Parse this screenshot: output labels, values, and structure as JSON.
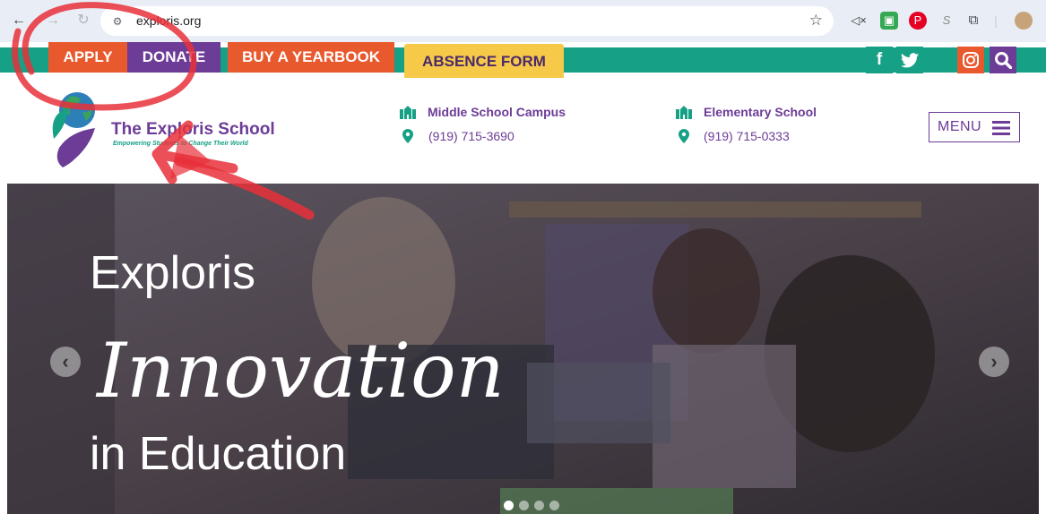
{
  "browser": {
    "url": "exploris.org",
    "back_icon": "arrow-left-icon",
    "forward_icon": "arrow-right-icon",
    "reload_icon": "reload-icon",
    "bookmark_icon": "star-icon",
    "extensions": [
      "mute-icon",
      "translate-icon",
      "pinterest-icon",
      "s-icon",
      "puzzle-icon",
      "profile-avatar"
    ]
  },
  "topnav": {
    "items": [
      {
        "label": "APPLY",
        "color": "#e8592e"
      },
      {
        "label": "DONATE",
        "color": "#6c3c97"
      },
      {
        "label": "BUY A YEARBOOK",
        "color": "#e8592e"
      },
      {
        "label": "ABSENCE FORM",
        "color": "#f7c948"
      }
    ],
    "social": [
      {
        "icon": "facebook-icon",
        "glyph": "f",
        "color": "#16a085"
      },
      {
        "icon": "twitter-icon",
        "glyph": "🐦",
        "color": "#16a085"
      },
      {
        "icon": "instagram-icon",
        "glyph": "◎",
        "color": "#e8592e"
      },
      {
        "icon": "search-icon",
        "glyph": "🔍",
        "color": "#6c3c97"
      }
    ]
  },
  "header": {
    "logo_name": "The Exploris School",
    "logo_tagline": "Empowering Students to Change Their World",
    "campuses": [
      {
        "name": "Middle School Campus",
        "phone": "(919) 715-3690"
      },
      {
        "name": "Elementary School",
        "phone": "(919) 715-0333"
      }
    ],
    "menu_label": "MENU"
  },
  "hero": {
    "line1": "Exploris",
    "line2": "Innovation",
    "line3": "in Education",
    "slides": 4,
    "active_slide": 1
  },
  "colors": {
    "purple": "#6c3c97",
    "teal": "#16a085",
    "orange": "#e8592e",
    "yellow": "#f7c948",
    "annotation_red": "#e8303a"
  }
}
